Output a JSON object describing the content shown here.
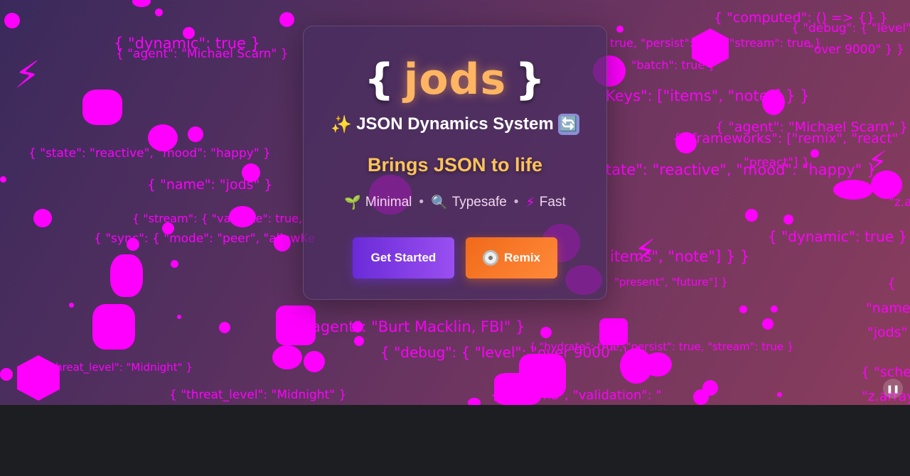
{
  "logo": {
    "open_brace": "{",
    "word": "jods",
    "close_brace": "}"
  },
  "subtitle": "JSON Dynamics System",
  "tagline": "Brings JSON to life",
  "features": [
    {
      "label": "Minimal",
      "icon": "sprout-icon"
    },
    {
      "label": "Typesafe",
      "icon": "magnifier-icon"
    },
    {
      "label": "Fast",
      "icon": "lightning-icon"
    }
  ],
  "feature_separator": "•",
  "buttons": {
    "get_started": "Get Started",
    "remix": "Remix"
  },
  "pause_icon": "pause-icon",
  "colors": {
    "background_gradient": [
      "#3a2a5c",
      "#8a3d5c"
    ],
    "floating_text": "#ff00ff",
    "logo_word": "#ffb561",
    "tagline": "#ffc35a",
    "get_started": [
      "#6a2bd8",
      "#9a4ff0"
    ],
    "remix": [
      "#f06a1a",
      "#ff8a3a"
    ],
    "bottom_bar": "#1d1e21"
  },
  "floating_snippets": [
    "{ \"computed\": () => {} }",
    "{ \"debug\": { \"level\":",
    "\"over 9000\" } }",
    "{ \"dynamic\": true }",
    "{ \"agent\": \"Michael Scarn\" }",
    "true, \"persist\":",
    "\"stream\": true }",
    "\"batch\": true }",
    "Keys\": [\"items\", \"note\"] } }",
    "{ \"agent\": \"Michael Scarn\" }",
    "{ \"frameworks\": [\"remix\", \"react\"",
    "\"preact\"] }",
    "{ \"state\": \"reactive\", \"mood\": \"happy\" }",
    "tate\": \"reactive\", \"mood\": \"happy\" }",
    "{ \"name\": \"jods\" }",
    "{ \"stream\": { \"validate\": true,",
    "{ \"sync\": { \"mode\": \"peer\", \"allowKe",
    "\"z.arr",
    "{ \"dynamic\": true }",
    "items\", \"note\"] } }",
    "\"present\", \"future\"] }",
    "{",
    "\"name\"",
    "\"jods\"",
    "agent\": \"Burt Macklin, FBI\" }",
    "{ \"debug\": { \"level\": \"over 9000\" } }",
    "{ \"hydrate\": true, \"persist\": true, \"stream\": true }",
    "hreat_level\": \"Midnight\" }",
    "{ \"threat_level\": \"Midnight\" }",
    "{ \"sche",
    "\"z.array",
    "{ \"schema\", \"validation\": \""
  ]
}
